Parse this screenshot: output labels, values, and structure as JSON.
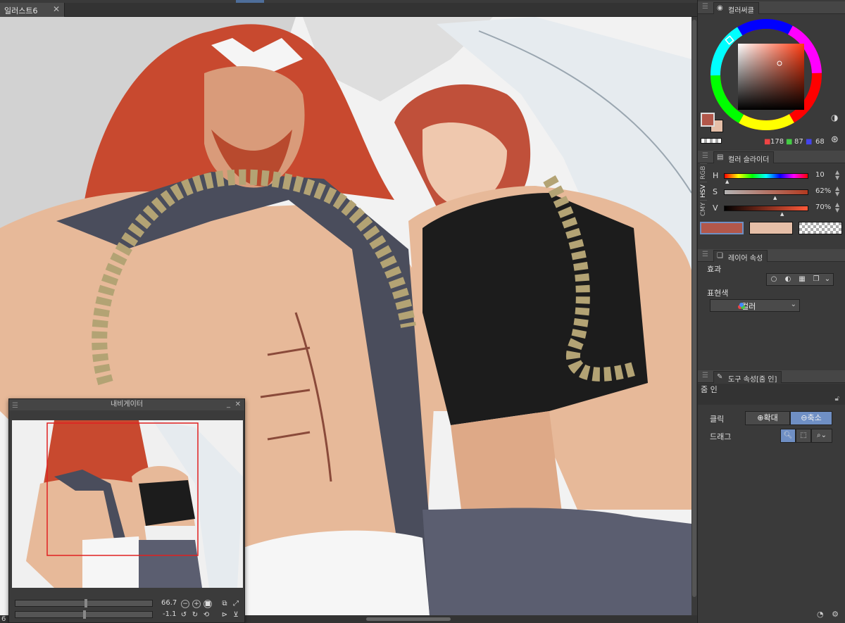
{
  "document_tab": {
    "label": "일러스트6",
    "close": "✕"
  },
  "page_indicator": "6",
  "navigator": {
    "title": "내비게이터",
    "zoom_value": "66.7",
    "rotation_value": "-1.1"
  },
  "color_circle": {
    "tab_label": "컬러써클",
    "r": "178",
    "g": "87",
    "b": "68",
    "main_color": "#b2574a",
    "sub_color": "#e6bfa8"
  },
  "color_slider": {
    "tab_label": "컬러 슬라이더",
    "side_tabs": [
      "RGB",
      "HSV",
      "CMY"
    ],
    "h_label": "H",
    "h_value": "10",
    "s_label": "S",
    "s_value": "62%",
    "v_label": "V",
    "v_value": "70%"
  },
  "layer_property": {
    "tab_label": "레이어 속성",
    "effect_label": "효과",
    "expression_label": "표현색",
    "expression_value": "컬러"
  },
  "tool_property": {
    "tab_label": "도구 속성[줌 인]",
    "tool_name": "줌 인",
    "click_label": "클릭",
    "zoom_in_label": "확대",
    "zoom_out_label": "축소",
    "drag_label": "드래그"
  },
  "colors": {
    "accent_blue": "#4e6e9a",
    "selected_button": "#6f8fc4",
    "nav_frame": "#e02020"
  }
}
